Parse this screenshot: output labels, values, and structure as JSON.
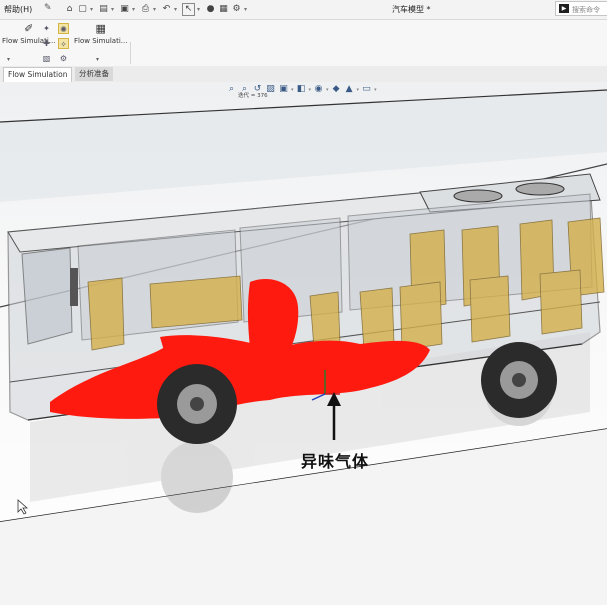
{
  "titlebar": {
    "help_menu": "帮助(H)",
    "pin_icon": "pin-icon",
    "document_title": "汽车模型 *",
    "search_placeholder": "搜索命令"
  },
  "quick_access": [
    "home-icon",
    "new-icon",
    "open-icon",
    "save-icon",
    "print-icon",
    "undo-icon",
    "select-icon",
    "rebuild-icon",
    "file-properties-icon",
    "options-icon"
  ],
  "ribbon": {
    "flow_sim_left": "Flow Simulati...",
    "flow_sim_right": "Flow Simulati..."
  },
  "tabs": [
    {
      "label": "Flow Simulation",
      "active": true
    },
    {
      "label": "分析准备",
      "active": false
    }
  ],
  "viewport": {
    "iteration_label": "迭代 = 376",
    "annotation": "异味气体"
  },
  "colors": {
    "plume": "#ff1a0f",
    "seats": "#d4b04a",
    "glass": "#c7ccd2",
    "tire": "#2b2b2b"
  }
}
